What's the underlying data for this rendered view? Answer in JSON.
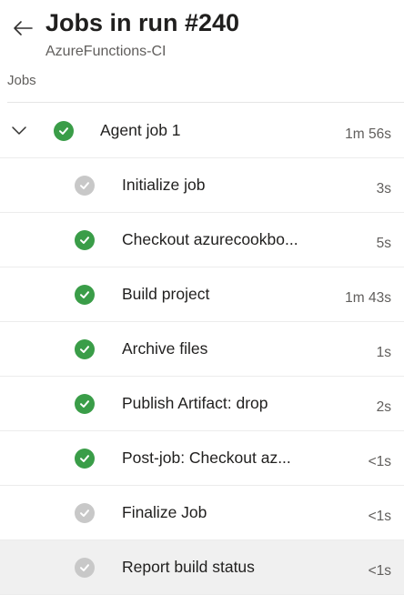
{
  "header": {
    "title": "Jobs in run #240",
    "subtitle": "AzureFunctions-CI",
    "back_icon": "arrow-left-icon"
  },
  "section_label": "Jobs",
  "colors": {
    "success": "#3a9d48",
    "skipped": "#c8c8c8",
    "selected_row": "#f0f0f0"
  },
  "jobs": [
    {
      "name": "Agent job 1",
      "duration": "1m 56s",
      "status": "success",
      "level": "parent",
      "expanded": true
    },
    {
      "name": "Initialize job",
      "duration": "3s",
      "status": "skipped",
      "level": "child"
    },
    {
      "name": "Checkout azurecookbo...",
      "duration": "5s",
      "status": "success",
      "level": "child"
    },
    {
      "name": "Build project",
      "duration": "1m 43s",
      "status": "success",
      "level": "child"
    },
    {
      "name": "Archive files",
      "duration": "1s",
      "status": "success",
      "level": "child"
    },
    {
      "name": "Publish Artifact: drop",
      "duration": "2s",
      "status": "success",
      "level": "child"
    },
    {
      "name": "Post-job: Checkout az...",
      "duration": "<1s",
      "status": "success",
      "level": "child"
    },
    {
      "name": "Finalize Job",
      "duration": "<1s",
      "status": "skipped",
      "level": "child"
    },
    {
      "name": "Report build status",
      "duration": "<1s",
      "status": "skipped",
      "level": "child",
      "selected": true
    }
  ]
}
